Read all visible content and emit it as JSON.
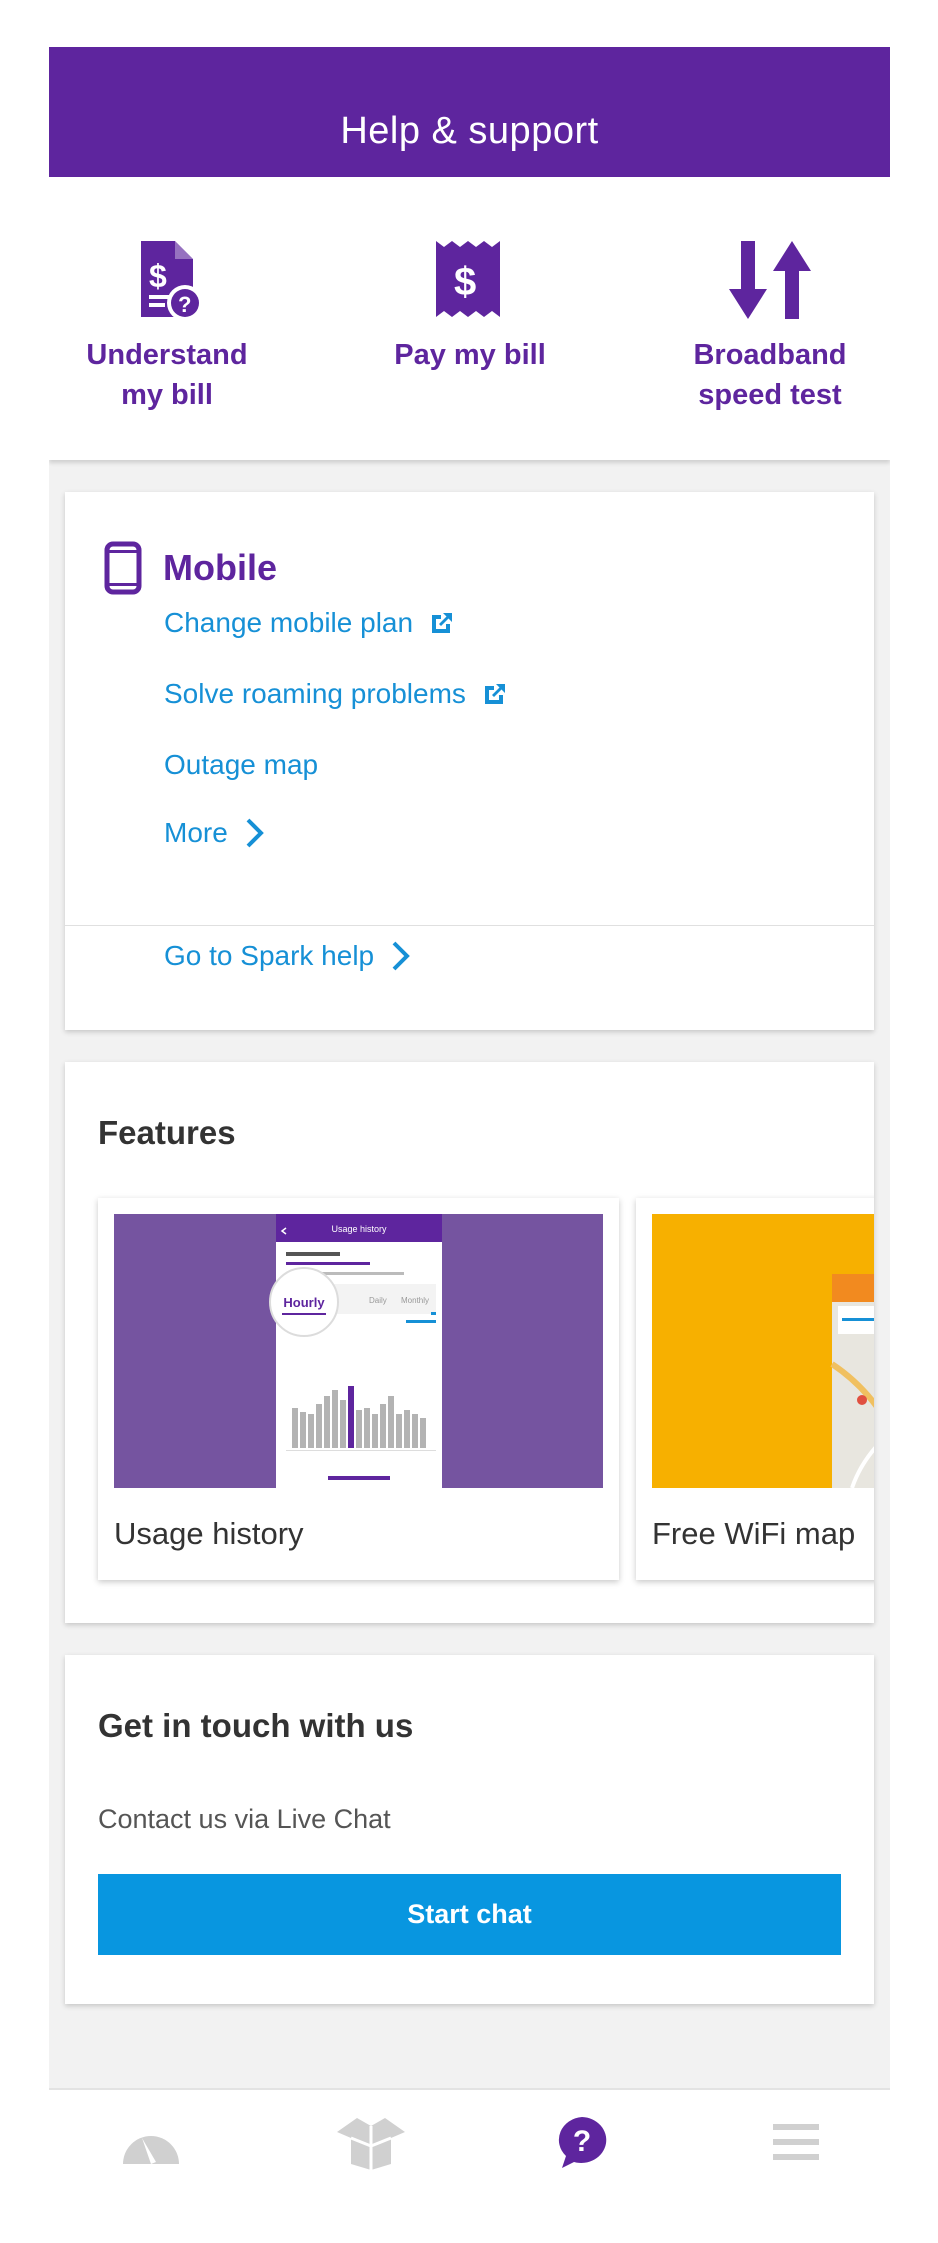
{
  "header": {
    "title": "Help & support"
  },
  "quick_actions": [
    {
      "label": "Understand\nmy bill",
      "icon": "bill-question-icon"
    },
    {
      "label": "Pay my bill",
      "icon": "dollar-receipt-icon"
    },
    {
      "label": "Broadband\nspeed test",
      "icon": "up-down-arrows-icon"
    }
  ],
  "mobile": {
    "title": "Mobile",
    "icon": "smartphone-icon",
    "links": [
      {
        "label": "Change mobile plan",
        "icon": "external-link-icon"
      },
      {
        "label": "Solve roaming problems",
        "icon": "external-link-icon"
      },
      {
        "label": "Outage map"
      },
      {
        "label": "More",
        "icon": "chevron-right-icon"
      }
    ],
    "footer_link": {
      "label": "Go to Spark help",
      "icon": "chevron-right-icon"
    }
  },
  "features": {
    "title": "Features",
    "items": [
      {
        "label": "Usage history",
        "thumb_bg": "#7554a0",
        "thumb_screen_title": "Usage history",
        "thumb_tabs": [
          "Hourly",
          "Daily",
          "Monthly"
        ]
      },
      {
        "label": "Free WiFi map",
        "thumb_bg": "#f7b000"
      }
    ]
  },
  "contact": {
    "title": "Get in touch with us",
    "subtitle": "Contact us via Live Chat",
    "button_label": "Start chat"
  },
  "bottom_nav": [
    {
      "icon": "gauge-icon",
      "active": false
    },
    {
      "icon": "package-icon",
      "active": false
    },
    {
      "icon": "help-bubble-icon",
      "active": true
    },
    {
      "icon": "menu-icon",
      "active": false
    }
  ],
  "colors": {
    "brand_purple": "#5e259e",
    "link_blue": "#1690d6",
    "button_blue": "#0896e0",
    "page_bg": "#f2f2f2",
    "nav_inactive": "#d0d0d0"
  }
}
